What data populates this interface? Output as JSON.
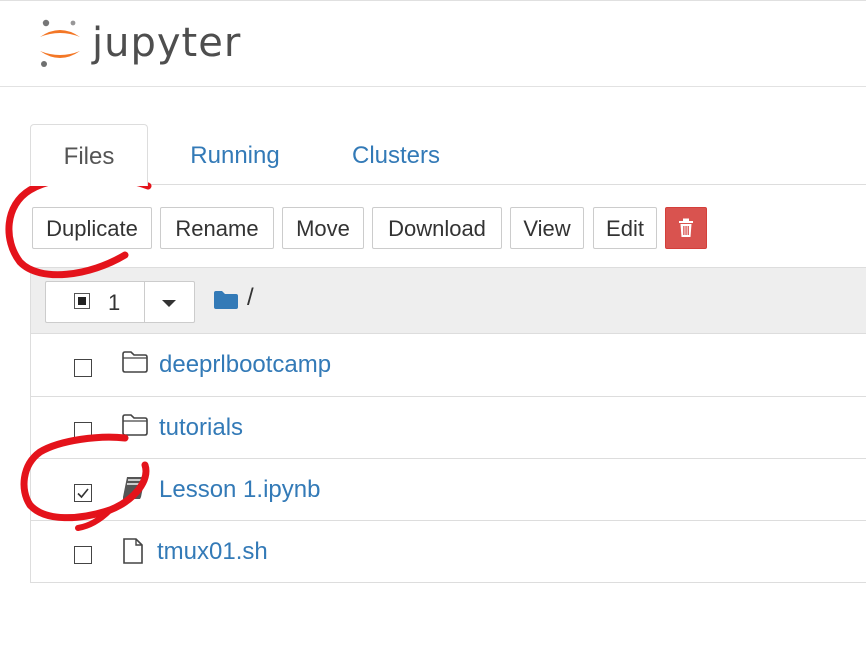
{
  "header": {
    "logo_text": "jupyter"
  },
  "tabs": [
    {
      "label": "Files",
      "active": true
    },
    {
      "label": "Running",
      "active": false
    },
    {
      "label": "Clusters",
      "active": false
    }
  ],
  "toolbar": {
    "duplicate": "Duplicate",
    "rename": "Rename",
    "move": "Move",
    "download": "Download",
    "view": "View",
    "edit": "Edit",
    "delete_icon": "trash-icon"
  },
  "list_header": {
    "selected_count": "1",
    "breadcrumb": "/"
  },
  "files": [
    {
      "name": "deeprlbootcamp",
      "type": "folder",
      "checked": false
    },
    {
      "name": "tutorials",
      "type": "folder",
      "checked": false
    },
    {
      "name": "Lesson 1.ipynb",
      "type": "notebook",
      "checked": true
    },
    {
      "name": "tmux01.sh",
      "type": "file",
      "checked": false
    }
  ],
  "colors": {
    "link": "#337ab7",
    "danger": "#d9534f",
    "logo_orange": "#f37726",
    "annotation_red": "#e4131b"
  }
}
